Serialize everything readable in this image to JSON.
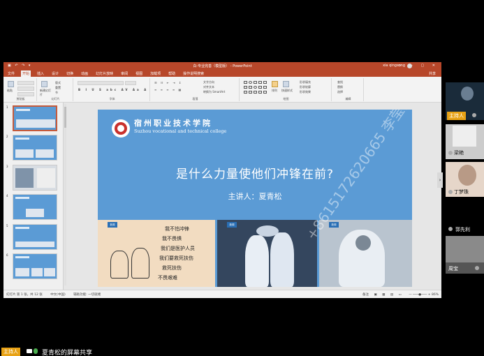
{
  "ppt": {
    "window_title": "白-专业完善（模型版） - PowerPoint",
    "quick_access": "▣ ↶ ↷ ▾",
    "user": "xia qingsong",
    "window_buttons": "▭ — ▢ ✕",
    "share": "共享",
    "tabs": [
      "文件",
      "开始",
      "插入",
      "设计",
      "切换",
      "动画",
      "幻灯片放映",
      "审阅",
      "视图",
      "加载项",
      "帮助",
      "操作说明搜索"
    ],
    "ribbon": {
      "clipboard_caption": "剪贴板",
      "slides_caption": "幻灯片",
      "font_caption": "字体",
      "paragraph_caption": "段落",
      "drawing_caption": "绘图",
      "editing_caption": "编辑",
      "new_slide": "新建幻灯片",
      "layout": "版式",
      "reset": "重置",
      "section": "节",
      "text_direction": "文字方向",
      "align_text": "对齐文本",
      "smartart": "转换为 SmartArt",
      "arrange": "排列",
      "quick_styles": "快速样式",
      "shape_fill": "形状填充",
      "shape_outline": "形状轮廓",
      "shape_effects": "形状效果",
      "find": "查找",
      "replace": "替换",
      "select": "选择",
      "paste": "粘贴"
    },
    "thumbnail_numbers": [
      "1",
      "2",
      "3",
      "4",
      "5",
      "6"
    ],
    "status": {
      "slide_count": "幻灯片 第 1 张，共 12 张",
      "language": "中文(中国)",
      "accessibility": "辅助功能: 一切就绪",
      "notes": "备注",
      "zoom": "86%"
    }
  },
  "slide": {
    "school_cn": "宿州职业技术学院",
    "school_en": "Suzhou vocational and technical college",
    "title": "是什么力量使他们冲锋在前?",
    "presenter": "主讲人：夏青松",
    "photo_badge": "新闻",
    "handwriting": [
      "我不怕冲锋",
      "我不畏惧",
      "我们是医护人员",
      "我们要救死扶伤",
      "救死扶伤",
      "不畏艰难"
    ],
    "watermark": "+8615172620665 李莹莹"
  },
  "participants": {
    "host_label": "主持人",
    "people": [
      {
        "name": "梁艳"
      },
      {
        "name": "丁梦珠"
      },
      {
        "name": "郭先利"
      },
      {
        "name": "周宝"
      }
    ]
  },
  "bottom": {
    "host_label": "主持人",
    "share_text": "夏青松的屏幕共享"
  }
}
